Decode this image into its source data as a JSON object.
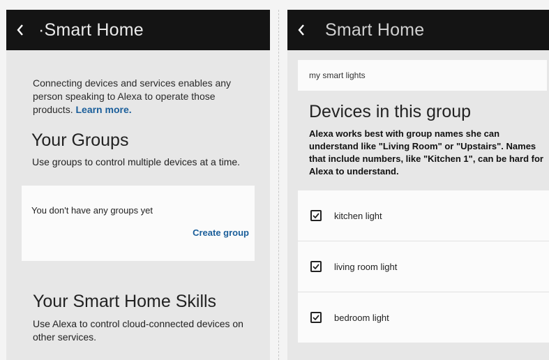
{
  "left_screen": {
    "header": {
      "title": "·Smart Home"
    },
    "intro": {
      "text": "Connecting devices and services enables any person speaking to Alexa to operate those products.",
      "link": "Learn more."
    },
    "groups": {
      "heading": "Your Groups",
      "description": "Use groups to control multiple devices at a time.",
      "empty_text": "You don't have any groups yet",
      "create_label": "Create group"
    },
    "skills": {
      "heading": "Your Smart Home Skills",
      "description": "Use Alexa to control cloud-connected devices on other services."
    }
  },
  "right_screen": {
    "header": {
      "title": "Smart Home"
    },
    "group_name_value": "my smart lights",
    "devices_heading": "Devices in this group",
    "devices_description": "Alexa works best with group names she can understand like \"Living Room\" or \"Upstairs\". Names that include numbers, like \"Kitchen 1\", can be hard for Alexa to understand.",
    "devices": [
      {
        "label": "kitchen light",
        "checked": true
      },
      {
        "label": "living room light",
        "checked": true
      },
      {
        "label": "bedroom light",
        "checked": true
      }
    ]
  },
  "colors": {
    "header_bg": "#141414",
    "link": "#1a5e9a",
    "panel_bg": "#e7e7e7",
    "card_bg": "#fbfbfb"
  },
  "icons": {
    "back": "chevron-left-icon",
    "checkbox": "checked-checkbox-icon"
  }
}
